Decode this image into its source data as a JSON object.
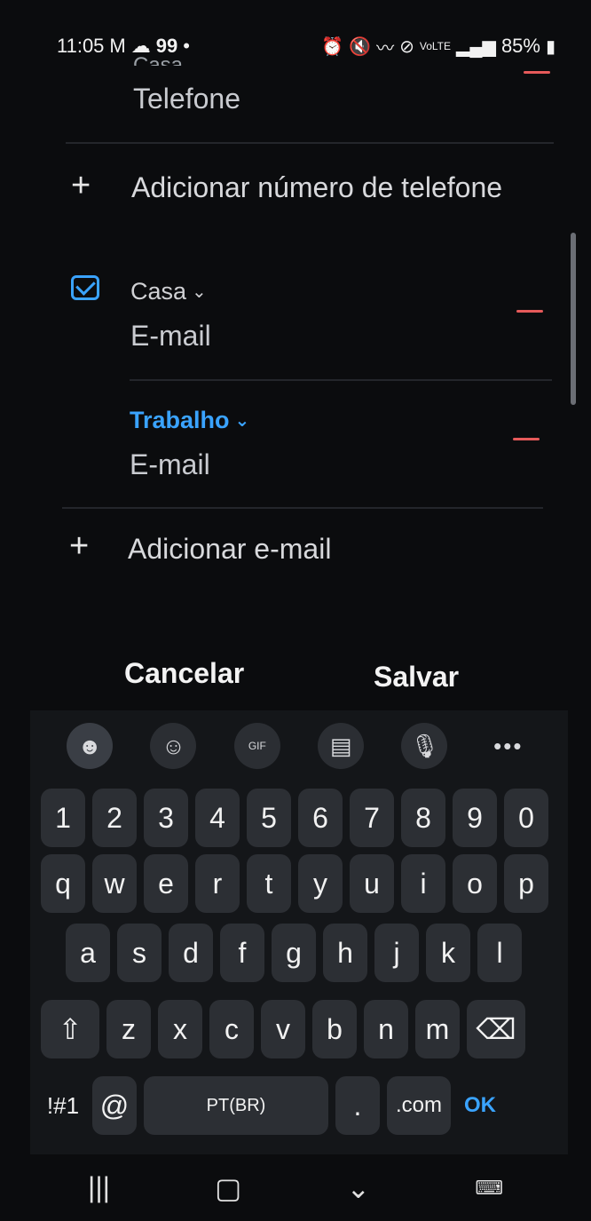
{
  "status_bar": {
    "time": "11:05",
    "notif_count": "99",
    "battery": "85%",
    "icons": [
      "gmail-icon",
      "cloud-icon",
      "dot-icon",
      "alarm-icon",
      "mute-icon",
      "wifi-icon",
      "block-icon",
      "volte-icon",
      "signal-icon",
      "battery-icon"
    ]
  },
  "form": {
    "partial_label": "Casa",
    "phone_value_placeholder": "Telefone",
    "add_phone": "Adicionar número de telefone",
    "emails": [
      {
        "type": "Casa",
        "placeholder": "E-mail",
        "active": false
      },
      {
        "type": "Trabalho",
        "placeholder": "E-mail",
        "active": true
      }
    ],
    "add_email": "Adicionar e-mail"
  },
  "actions": {
    "cancel": "Cancelar",
    "save": "Salvar"
  },
  "keyboard": {
    "toolbar": [
      "emoji-icon",
      "sticker-icon",
      "gif-icon",
      "clipboard-icon",
      "mic-icon",
      "more-icon"
    ],
    "row_numbers": [
      "1",
      "2",
      "3",
      "4",
      "5",
      "6",
      "7",
      "8",
      "9",
      "0"
    ],
    "row_1": [
      "q",
      "w",
      "e",
      "r",
      "t",
      "y",
      "u",
      "i",
      "o",
      "p"
    ],
    "row_2": [
      "a",
      "s",
      "d",
      "f",
      "g",
      "h",
      "j",
      "k",
      "l"
    ],
    "row_3": [
      "z",
      "x",
      "c",
      "v",
      "b",
      "n",
      "m"
    ],
    "bottom": {
      "symbols": "!#1",
      "at": "@",
      "language": "PT(BR)",
      "dot": ".",
      "dotcom": ".com",
      "ok": "OK"
    }
  },
  "colors": {
    "accent": "#3aa3ff",
    "remove": "#e65a5a",
    "background": "#0b0c0e"
  },
  "nav_bar": {
    "icons": [
      "recents-icon",
      "home-icon",
      "back-icon",
      "keyboard-hide-icon"
    ]
  }
}
